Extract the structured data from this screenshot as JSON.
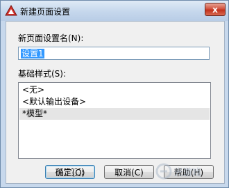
{
  "window": {
    "title": "新建页面设置",
    "close_label": "x",
    "app_icon": "autocad-icon"
  },
  "form": {
    "name_label": "新页面设置名(N):",
    "name_value": "设置1",
    "base_label": "基础样式(S):",
    "base_styles": [
      {
        "label": "<无>",
        "selected": false
      },
      {
        "label": "<默认输出设备>",
        "selected": false
      },
      {
        "label": "*模型*",
        "selected": true
      }
    ]
  },
  "buttons": {
    "ok": "确定(O)",
    "cancel": "取消(C)",
    "help": "帮助(H)"
  },
  "watermark": {
    "text": "光游戏"
  }
}
